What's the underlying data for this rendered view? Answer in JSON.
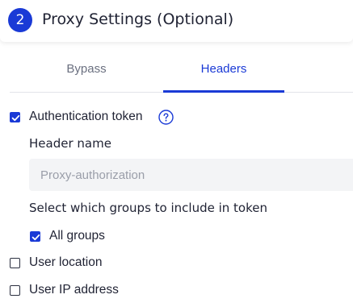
{
  "header": {
    "step_number": "2",
    "title": "Proxy Settings (Optional)"
  },
  "tabs": [
    {
      "label": "Bypass",
      "active": false
    },
    {
      "label": "Headers",
      "active": true
    }
  ],
  "auth_token": {
    "label": "Authentication token",
    "checked": true,
    "help_icon": "question-circle-icon"
  },
  "header_name": {
    "label": "Header name",
    "value": "",
    "placeholder": "Proxy-authorization"
  },
  "groups": {
    "heading": "Select which groups to include in token",
    "all_groups_label": "All groups",
    "all_groups_checked": true
  },
  "options": [
    {
      "label": "User location",
      "checked": false
    },
    {
      "label": "User IP address",
      "checked": false
    }
  ],
  "colors": {
    "accent": "#1a3ad6",
    "text": "#1f2233",
    "muted": "#6b7080",
    "input_bg": "#f3f4f6"
  }
}
